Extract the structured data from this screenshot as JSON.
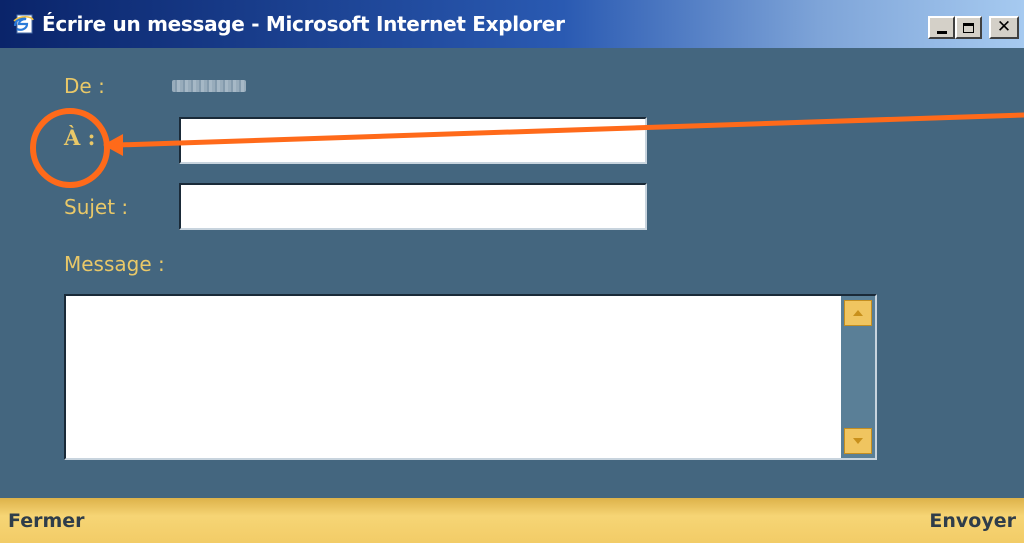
{
  "window": {
    "title": "Écrire un message - Microsoft Internet Explorer",
    "icon": "ie-page-icon",
    "controls": [
      "minimize-icon",
      "maximize-icon",
      "close-icon"
    ]
  },
  "form": {
    "from_label": "De :",
    "from_value_redacted": true,
    "to_label": "À :",
    "to_value": "",
    "subject_label": "Sujet :",
    "subject_value": "",
    "message_label": "Message :",
    "message_value": ""
  },
  "footer": {
    "close_label": "Fermer",
    "send_label": "Envoyer"
  },
  "annotation": {
    "color": "#ff6a1a",
    "shape": "circle-and-arrow",
    "highlights": "to-label"
  },
  "colors": {
    "background": "#44667f",
    "label": "#e9c868",
    "footer": "#f2cc67",
    "titlebar": "#0a246a"
  }
}
